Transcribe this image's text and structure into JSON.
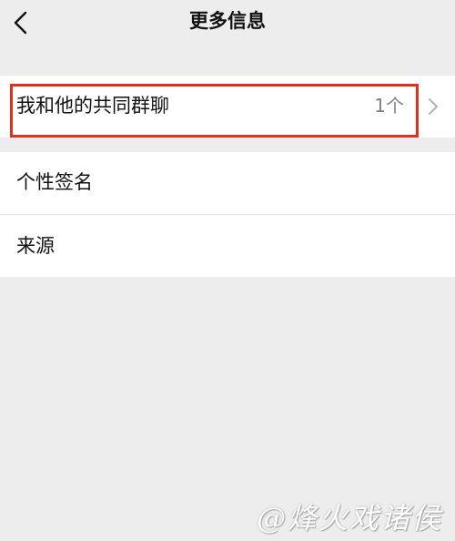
{
  "navbar": {
    "title": "更多信息",
    "back_icon": "chevron-left-icon"
  },
  "rows": {
    "shared_groups": {
      "label": "我和他的共同群聊",
      "value": "1个",
      "arrow_icon": "chevron-right-icon",
      "highlight_color": "#E0301E"
    },
    "signature": {
      "label": "个性签名"
    },
    "source": {
      "label": "来源"
    }
  },
  "watermark": {
    "text": "@烽火戏诸侯"
  },
  "colors": {
    "background": "#EDEDED",
    "row_background": "#FFFFFF",
    "secondary_text": "#7F7F7F"
  }
}
